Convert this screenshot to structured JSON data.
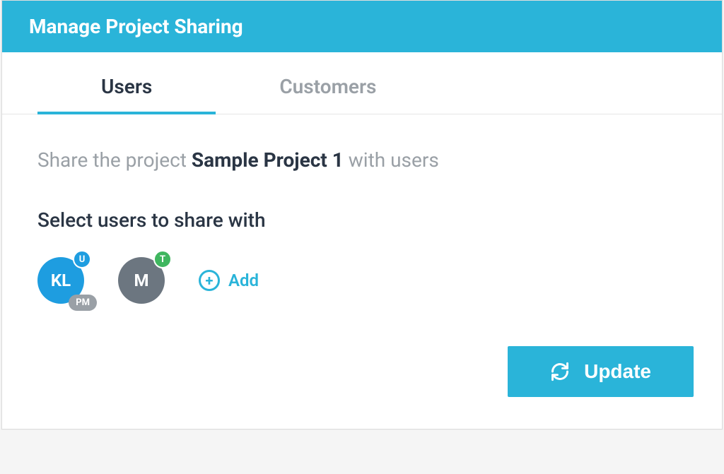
{
  "header": {
    "title": "Manage Project Sharing"
  },
  "tabs": {
    "users": "Users",
    "customers": "Customers"
  },
  "content": {
    "share_prefix": "Share the project ",
    "project_name": "Sample Project 1",
    "share_suffix": " with users",
    "select_label": "Select users to share with"
  },
  "users": [
    {
      "initials": "KL",
      "badge_top": "U",
      "badge_bottom": "PM",
      "avatar_color": "blue"
    },
    {
      "initials": "M",
      "badge_top": "T",
      "avatar_color": "gray"
    }
  ],
  "actions": {
    "add_label": "Add",
    "update_label": "Update"
  }
}
